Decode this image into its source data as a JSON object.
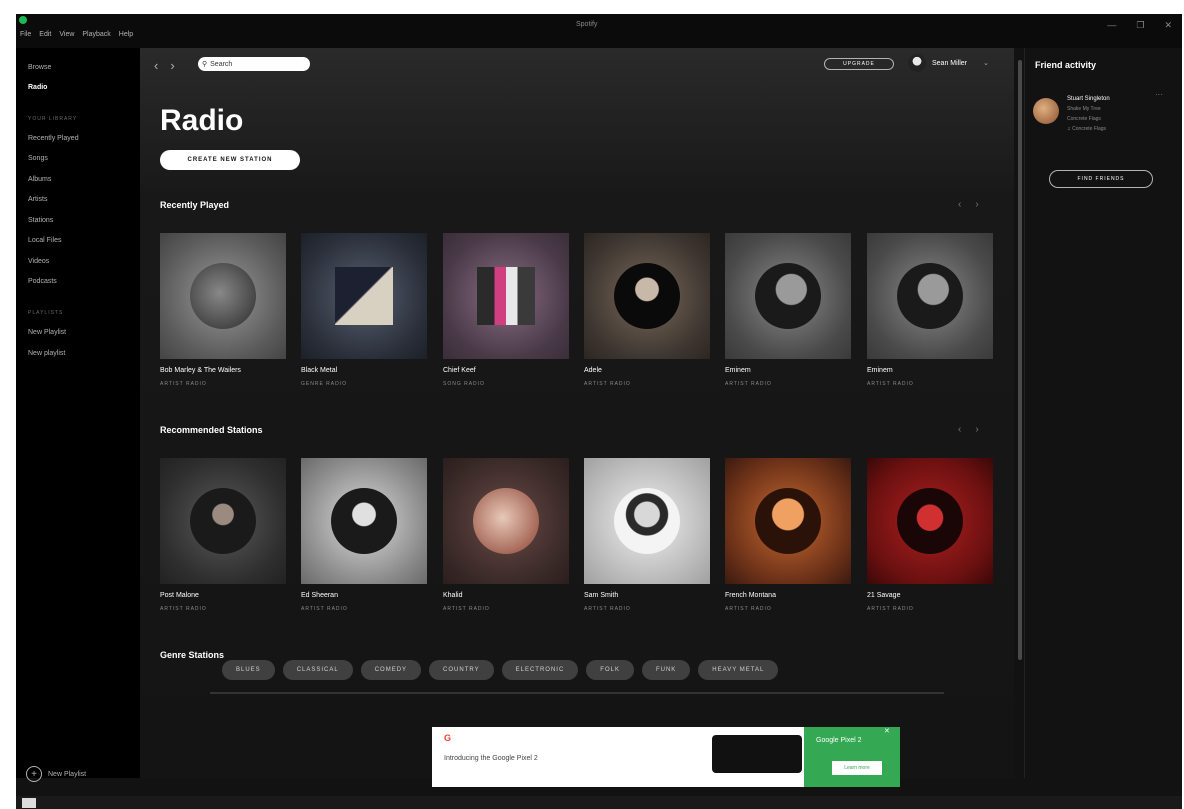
{
  "window": {
    "title": "Spotify",
    "menu": [
      "File",
      "Edit",
      "View",
      "Playback",
      "Help"
    ],
    "controls": [
      "—",
      "❐",
      "✕"
    ]
  },
  "sidebar": {
    "nav": [
      "Browse",
      "Radio"
    ],
    "library_heading": "YOUR LIBRARY",
    "library": [
      "Recently Played",
      "Songs",
      "Albums",
      "Artists",
      "Stations",
      "Local Files",
      "Videos",
      "Podcasts"
    ],
    "playlists_heading": "PLAYLISTS",
    "playlists": [
      "New Playlist",
      "New playlist"
    ],
    "new_playlist": "New Playlist"
  },
  "topbar": {
    "back": "‹",
    "forward": "›",
    "search_placeholder": "Search",
    "upgrade": "UPGRADE",
    "user_name": "Sean Miller",
    "dropdown": "⌄"
  },
  "main": {
    "title": "Radio",
    "create_station": "CREATE NEW STATION",
    "recently_played": {
      "heading": "Recently Played",
      "cards": [
        {
          "title": "Bob Marley & The Wailers",
          "sub": "ARTIST RADIO"
        },
        {
          "title": "Black Metal",
          "sub": "GENRE RADIO"
        },
        {
          "title": "Chief Keef",
          "sub": "SONG RADIO"
        },
        {
          "title": "Adele",
          "sub": "ARTIST RADIO"
        },
        {
          "title": "Eminem",
          "sub": "ARTIST RADIO"
        },
        {
          "title": "Eminem",
          "sub": "ARTIST RADIO"
        }
      ]
    },
    "recommended": {
      "heading": "Recommended Stations",
      "cards": [
        {
          "title": "Post Malone",
          "sub": "ARTIST RADIO"
        },
        {
          "title": "Ed Sheeran",
          "sub": "ARTIST RADIO"
        },
        {
          "title": "Khalid",
          "sub": "ARTIST RADIO"
        },
        {
          "title": "Sam Smith",
          "sub": "ARTIST RADIO"
        },
        {
          "title": "French Montana",
          "sub": "ARTIST RADIO"
        },
        {
          "title": "21 Savage",
          "sub": "ARTIST RADIO"
        }
      ]
    },
    "genre": {
      "heading": "Genre Stations",
      "chips": [
        "BLUES",
        "CLASSICAL",
        "COMEDY",
        "COUNTRY",
        "ELECTRONIC",
        "FOLK",
        "FUNK",
        "HEAVY METAL"
      ]
    },
    "arrow_left": "‹",
    "arrow_right": "›"
  },
  "friends": {
    "title": "Friend activity",
    "entry": {
      "name": "Stuart Singleton",
      "line1": "Shake My Tree",
      "line2": "Concrete Flags",
      "line3": "Concrete Flags"
    },
    "more": "···",
    "find_friends": "FIND FRIENDS"
  },
  "ad": {
    "logo": "G",
    "text": "Introducing the Google Pixel 2",
    "headline": "Google Pixel 2",
    "cta": "Learn more",
    "close": "✕"
  }
}
